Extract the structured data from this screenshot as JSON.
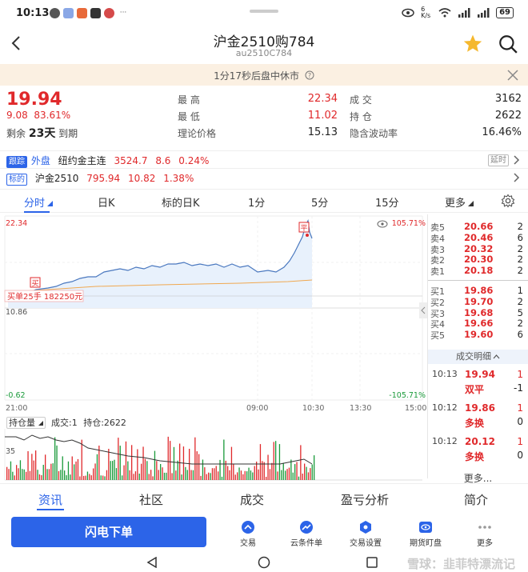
{
  "status": {
    "time": "10:13",
    "net_speed": "6 K/s",
    "battery": "69"
  },
  "header": {
    "title": "沪金2510购784",
    "subtitle": "au2510C784"
  },
  "notice": "1分17秒后盘中休市",
  "quote": {
    "price": "19.94",
    "change": "9.08",
    "change_pct": "83.61%",
    "remain_prefix": "剩余",
    "remain_days": "23天",
    "remain_suffix": "到期",
    "high_label": "最  高",
    "high": "22.34",
    "low_label": "最  低",
    "low": "11.02",
    "theo_label": "理论价格",
    "theo": "15.13",
    "volume_label": "成  交",
    "volume": "3162",
    "oi_label": "持  仓",
    "oi": "2622",
    "iv_label": "隐含波动率",
    "iv": "16.46%"
  },
  "track": {
    "tag": "跟踪",
    "market": "外盘",
    "name": "纽约金主连",
    "price": "3524.7",
    "change": "8.6",
    "pct": "0.24%",
    "delay": "延时"
  },
  "underlying": {
    "tag": "标的",
    "name": "沪金2510",
    "price": "795.94",
    "change": "10.82",
    "pct": "1.38%"
  },
  "period_tabs": [
    "分时",
    "日K",
    "标的日K",
    "1分",
    "5分",
    "15分",
    "更多"
  ],
  "chart": {
    "ymax": "22.34",
    "mid": "10.86",
    "ymin": "-0.62",
    "pct_max": "105.71%",
    "pct_min": "-105.71%",
    "times": [
      "21:00",
      "09:00",
      "10:30",
      "13:30",
      "15:00"
    ],
    "buy_marker": "买",
    "close_marker": "平",
    "order_label": "买单25手  182250元"
  },
  "vol_header": {
    "selector": "持仓量",
    "volume": "成交:1",
    "oi": "持仓:2622",
    "level": "35"
  },
  "book": {
    "asks": [
      {
        "label": "卖5",
        "price": "20.66",
        "qty": "2"
      },
      {
        "label": "卖4",
        "price": "20.46",
        "qty": "6"
      },
      {
        "label": "卖3",
        "price": "20.32",
        "qty": "2"
      },
      {
        "label": "卖2",
        "price": "20.30",
        "qty": "2"
      },
      {
        "label": "卖1",
        "price": "20.18",
        "qty": "2"
      }
    ],
    "bids": [
      {
        "label": "买1",
        "price": "19.86",
        "qty": "1"
      },
      {
        "label": "买2",
        "price": "19.70",
        "qty": "2"
      },
      {
        "label": "买3",
        "price": "19.68",
        "qty": "5"
      },
      {
        "label": "买4",
        "price": "19.66",
        "qty": "2"
      },
      {
        "label": "买5",
        "price": "19.60",
        "qty": "6"
      }
    ],
    "detail_title": "成交明细",
    "trades": [
      {
        "time": "10:13",
        "price": "19.94",
        "qty": "1",
        "type": "双平",
        "oi": "-1"
      },
      {
        "time": "10:12",
        "price": "19.86",
        "qty": "1",
        "type": "多换",
        "oi": "0"
      },
      {
        "time": "10:12",
        "price": "20.12",
        "qty": "1",
        "type": "多换",
        "oi": "0"
      }
    ],
    "more": "更多..."
  },
  "bottom_tabs": [
    "资讯",
    "社区",
    "成交",
    "盈亏分析",
    "简介"
  ],
  "actions": {
    "flash": "闪电下单",
    "items": [
      "交易",
      "云条件单",
      "交易设置",
      "期货盯盘",
      "更多"
    ]
  },
  "watermark": "雪球：韭菲特漂流记",
  "colors": {
    "up": "#e0292b",
    "down": "#1a9a3a",
    "accent": "#2c64e8"
  }
}
